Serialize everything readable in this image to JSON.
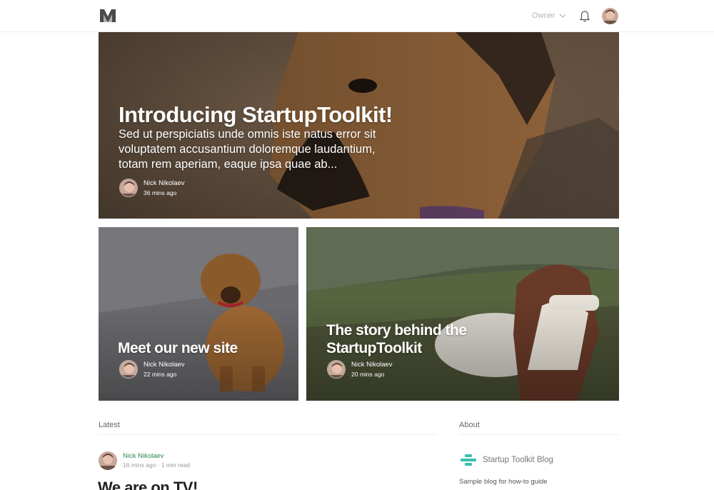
{
  "header": {
    "logo": "medium-logo-icon",
    "owner_label": "Owner",
    "icons": [
      "chevron-down-icon",
      "bell-icon",
      "avatar"
    ]
  },
  "hero": {
    "title": "Introducing StartupToolkit!",
    "excerpt": "Sed ut perspiciatis unde omnis iste natus error sit voluptatem accusantium doloremque laudantium, totam rem aperiam, eaque ipsa quae ab...",
    "author": "Nick Nikolaev",
    "time": "36 mins ago"
  },
  "cards": [
    {
      "title": "Meet our new site",
      "author": "Nick Nikolaev",
      "time": "22 mins ago"
    },
    {
      "title": "The story behind the StartupToolkit",
      "author": "Nick Nikolaev",
      "time": "20 mins ago"
    }
  ],
  "latest": {
    "heading": "Latest",
    "post": {
      "author": "Nick Nikolaev",
      "meta": "16 mins ago · 1 min read",
      "title": "We are on TV!"
    }
  },
  "about": {
    "heading": "About",
    "blog_name": "Startup Toolkit Blog",
    "description": "Sample blog for how-to guide"
  },
  "colors": {
    "author_link": "#2e8b57",
    "blog_logo": "#3bbfad"
  }
}
